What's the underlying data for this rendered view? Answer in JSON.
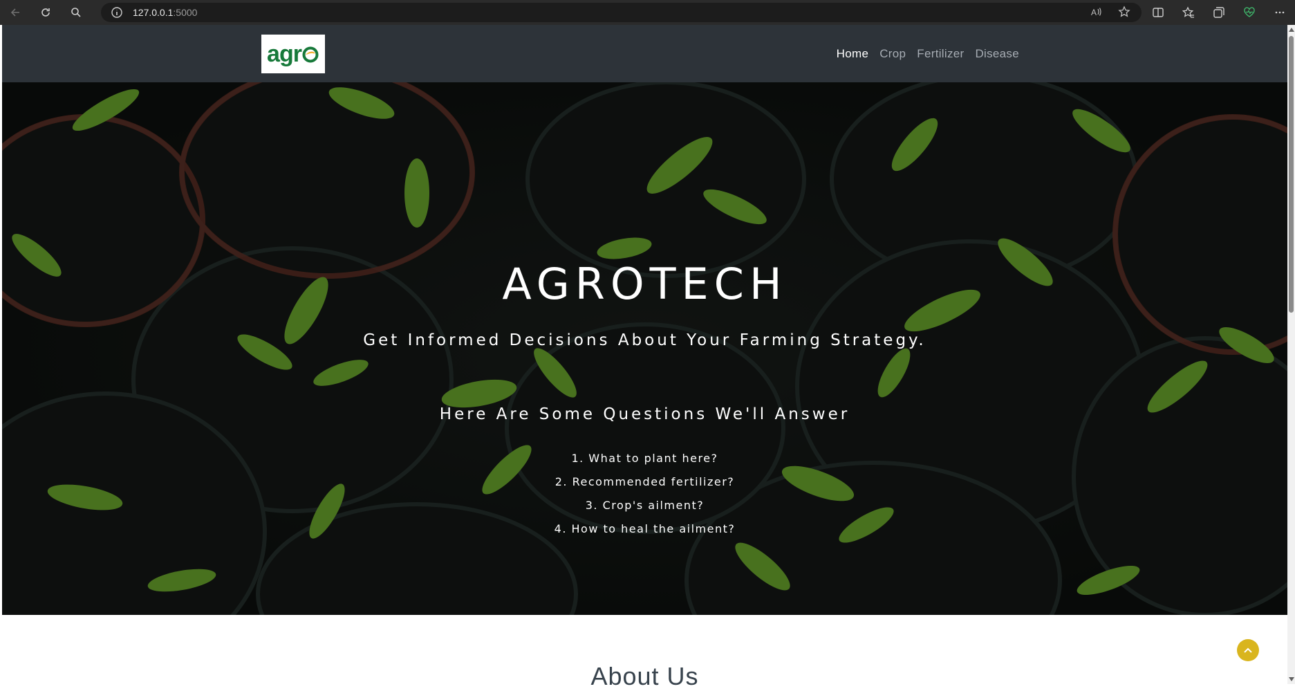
{
  "browser": {
    "url_host": "127.0.0.1",
    "url_port": ":5000"
  },
  "logo": {
    "text": "agr"
  },
  "nav": {
    "items": [
      {
        "label": "Home",
        "active": true
      },
      {
        "label": "Crop",
        "active": false
      },
      {
        "label": "Fertilizer",
        "active": false
      },
      {
        "label": "Disease",
        "active": false
      }
    ]
  },
  "hero": {
    "title": "AGROTECH",
    "subtitle": "Get Informed Decisions About Your Farming Strategy.",
    "questions_heading": "Here Are Some Questions We'll Answer",
    "questions": [
      "1. What to plant here?",
      "2. Recommended fertilizer?",
      "3. Crop's ailment?",
      "4. How to heal the ailment?"
    ]
  },
  "about": {
    "title": "About Us"
  },
  "colors": {
    "header_bg": "#2d3339",
    "logo_green": "#17793a",
    "back_to_top": "#d9b51e"
  }
}
